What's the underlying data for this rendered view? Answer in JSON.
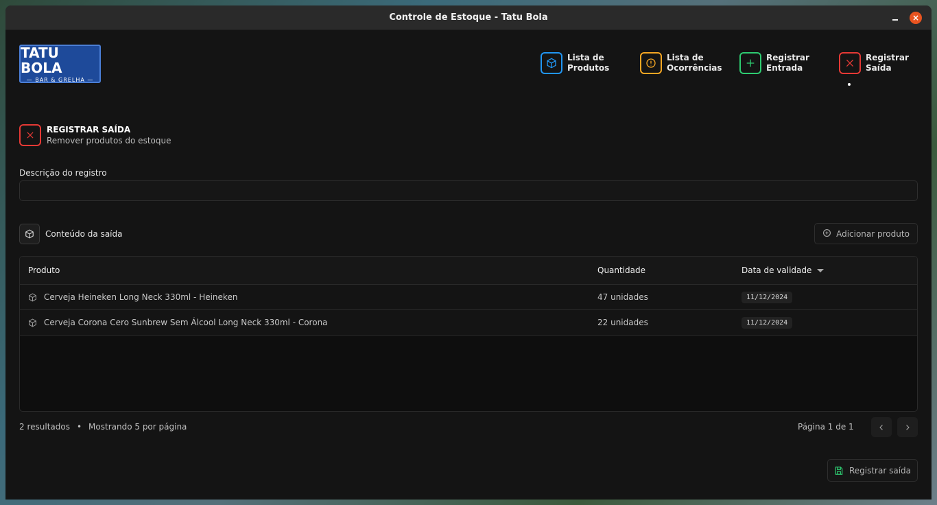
{
  "window": {
    "title": "Controle de Estoque - Tatu Bola"
  },
  "logo": {
    "line1": "TATU BOLA",
    "line2": "— BAR & GRELHA —"
  },
  "nav": [
    {
      "label": "Lista de\nProdutos",
      "icon": "box-icon",
      "color": "#2196f3"
    },
    {
      "label": "Lista de\nOcorrências",
      "icon": "alert-circle-icon",
      "color": "#f5a623"
    },
    {
      "label": "Registrar\nEntrada",
      "icon": "plus-icon",
      "color": "#2ecc71"
    },
    {
      "label": "Registrar\nSaída",
      "icon": "x-icon",
      "color": "#e53935",
      "active": true
    }
  ],
  "section": {
    "title": "REGISTRAR SAÍDA",
    "subtitle": "Remover produtos do estoque"
  },
  "description": {
    "label": "Descrição do registro",
    "value": "",
    "placeholder": ""
  },
  "content": {
    "title": "Conteúdo da saída",
    "add_button": "Adicionar produto"
  },
  "table": {
    "headers": [
      "Produto",
      "Quantidade",
      "Data de validade"
    ],
    "rows": [
      {
        "product": "Cerveja Heineken Long Neck 330ml - Heineken",
        "quantity": "47 unidades",
        "expiry": "11/12/2024"
      },
      {
        "product": "Cerveja Corona Cero Sunbrew Sem Álcool Long Neck 330ml - Corona",
        "quantity": "22 unidades",
        "expiry": "11/12/2024"
      }
    ]
  },
  "pagination": {
    "results": "2 resultados",
    "per_page": "Mostrando 5 por página",
    "page": "Página 1 de 1"
  },
  "save_button": "Registrar saída"
}
